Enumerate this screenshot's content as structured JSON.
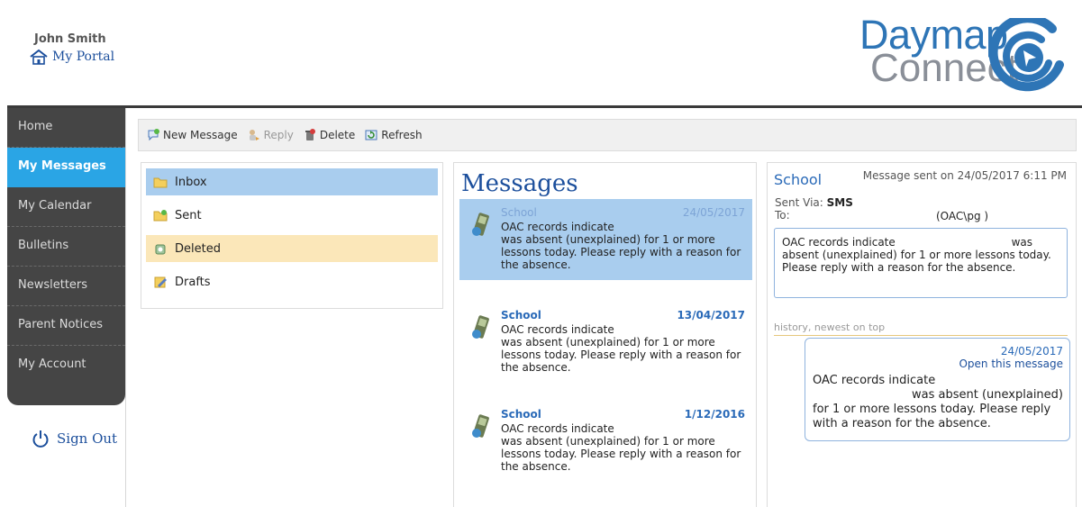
{
  "user": {
    "name": "John Smith",
    "portal_link": "My Portal"
  },
  "brand": {
    "line1": "Daymap",
    "line2": "Connect",
    "blue": "#2e75b6",
    "gray": "#8a8f98"
  },
  "sidebar": {
    "items": [
      {
        "label": "Home"
      },
      {
        "label": "My Messages",
        "active": true
      },
      {
        "label": "My Calendar"
      },
      {
        "label": "Bulletins"
      },
      {
        "label": "Newsletters"
      },
      {
        "label": "Parent Notices"
      },
      {
        "label": "My Account"
      }
    ],
    "sign_out": "Sign Out"
  },
  "toolbar": {
    "new_message": "New Message",
    "reply": "Reply",
    "delete": "Delete",
    "refresh": "Refresh"
  },
  "folders": [
    {
      "label": "Inbox",
      "icon": "inbox-folder-icon"
    },
    {
      "label": "Sent",
      "icon": "sent-folder-icon"
    },
    {
      "label": "Deleted",
      "icon": "deleted-folder-icon"
    },
    {
      "label": "Drafts",
      "icon": "drafts-folder-icon"
    }
  ],
  "messages_panel": {
    "title": "Messages",
    "items": [
      {
        "sender": "School",
        "date": "24/05/2017",
        "line1": "OAC records indicate",
        "line2": "was absent (unexplained) for 1 or more lessons today. Please reply with a reason for the absence."
      },
      {
        "sender": "School",
        "date": "13/04/2017",
        "line1": "OAC records indicate",
        "line2": "was absent (unexplained) for 1 or more lessons today. Please reply with a reason for the absence."
      },
      {
        "sender": "School",
        "date": "1/12/2016",
        "line1": "OAC records indicate",
        "line2": "was absent (unexplained) for 1 or more lessons today. Please reply with a reason for the absence."
      }
    ]
  },
  "detail": {
    "sender": "School",
    "sent_on": "Message sent on 24/05/2017 6:11 PM",
    "sent_via_label": "Sent Via:",
    "sent_via_value": "SMS",
    "to_label": "To:",
    "to_value": "(OAC\\pg          )",
    "body_line1": "OAC records indicate",
    "body_was": "was",
    "body_rest": "absent (unexplained) for 1 or more lessons today. Please reply with a reason for the absence.",
    "history_label": "history, newest on top",
    "history": {
      "date": "24/05/2017",
      "open_link": "Open this message",
      "line1": "OAC records indicate",
      "line2": "was absent (unexplained)",
      "line3": "for 1 or more lessons today. Please reply with a reason for the absence."
    }
  }
}
